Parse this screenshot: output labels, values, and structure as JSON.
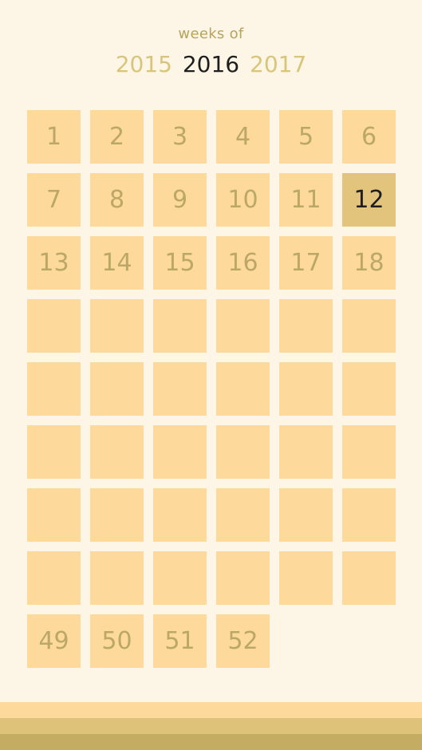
{
  "header": {
    "subtitle": "weeks of",
    "years": [
      {
        "label": "2015",
        "state": "inactive"
      },
      {
        "label": "2016",
        "state": "active"
      },
      {
        "label": "2017",
        "state": "inactive"
      }
    ]
  },
  "weeks": {
    "total": 52,
    "current": 12,
    "visible_labels": [
      1,
      2,
      3,
      4,
      5,
      6,
      7,
      8,
      9,
      10,
      11,
      12,
      13,
      14,
      15,
      16,
      17,
      18,
      49,
      50,
      51,
      52
    ]
  },
  "colors": {
    "background": "#fdf6e6",
    "cell": "#fdda9b",
    "cell_current": "#e2c47d",
    "cell_text": "#bba768",
    "active_text": "#1e1e1e",
    "inactive_year": "#d8c57c"
  }
}
